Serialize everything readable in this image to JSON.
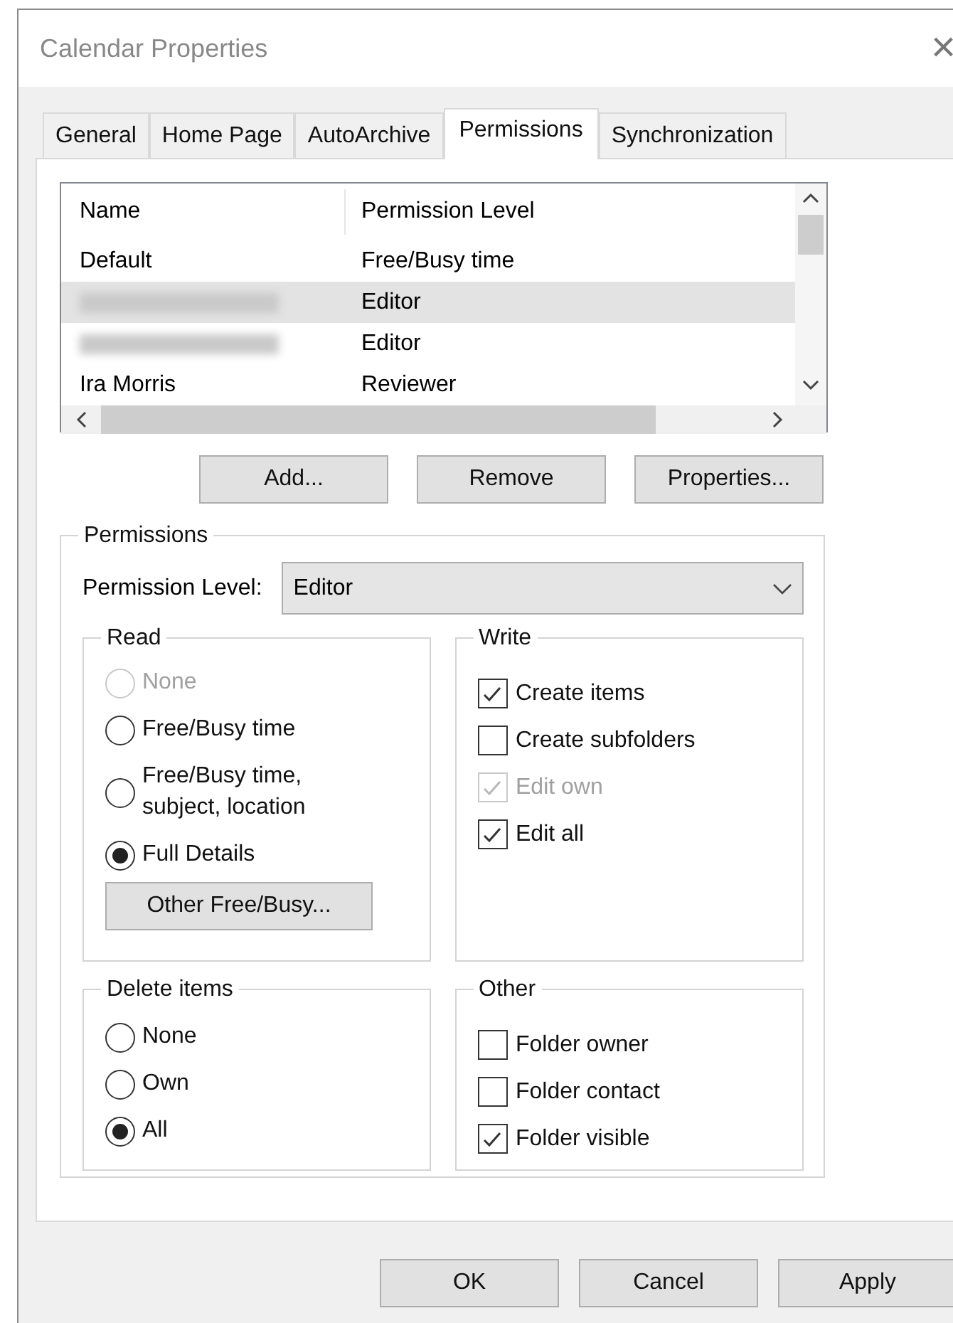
{
  "window": {
    "title": "Calendar Properties",
    "close": "×"
  },
  "tabs": [
    {
      "label": "General",
      "selected": false
    },
    {
      "label": "Home Page",
      "selected": false
    },
    {
      "label": "AutoArchive",
      "selected": false
    },
    {
      "label": "Permissions",
      "selected": true
    },
    {
      "label": "Synchronization",
      "selected": false
    }
  ],
  "table": {
    "columns": [
      "Name",
      "Permission Level"
    ],
    "rows": [
      {
        "name": "Default",
        "redacted": false,
        "level": "Free/Busy time",
        "selected": false
      },
      {
        "redacted": true,
        "level": "Editor",
        "selected": true
      },
      {
        "redacted": true,
        "level": "Editor",
        "selected": false
      },
      {
        "name": "Ira Morris",
        "redacted": false,
        "level": "Reviewer",
        "selected": false
      }
    ]
  },
  "list_buttons": [
    "Add...",
    "Remove",
    "Properties..."
  ],
  "permissions": {
    "title": "Permissions",
    "level_label": "Permission Level:",
    "level_value": "Editor",
    "read": {
      "title": "Read",
      "options": [
        {
          "label": "None",
          "selected": false,
          "disabled": true
        },
        {
          "label": "Free/Busy time",
          "selected": false,
          "disabled": false
        },
        {
          "label": "Free/Busy time,\nsubject, location",
          "selected": false,
          "disabled": false
        },
        {
          "label": "Full Details",
          "selected": true,
          "disabled": false
        }
      ],
      "button": "Other Free/Busy..."
    },
    "write": {
      "title": "Write",
      "options": [
        {
          "label": "Create items",
          "checked": true,
          "disabled": false
        },
        {
          "label": "Create subfolders",
          "checked": false,
          "disabled": false
        },
        {
          "label": "Edit own",
          "checked": true,
          "disabled": true
        },
        {
          "label": "Edit all",
          "checked": true,
          "disabled": false
        }
      ]
    },
    "delete": {
      "title": "Delete items",
      "options": [
        {
          "label": "None",
          "selected": false,
          "disabled": false
        },
        {
          "label": "Own",
          "selected": false,
          "disabled": false
        },
        {
          "label": "All",
          "selected": true,
          "disabled": false
        }
      ]
    },
    "other": {
      "title": "Other",
      "options": [
        {
          "label": "Folder owner",
          "checked": false,
          "disabled": false
        },
        {
          "label": "Folder contact",
          "checked": false,
          "disabled": false
        },
        {
          "label": "Folder visible",
          "checked": true,
          "disabled": false
        }
      ]
    }
  },
  "footer_buttons": [
    "OK",
    "Cancel",
    "Apply"
  ]
}
